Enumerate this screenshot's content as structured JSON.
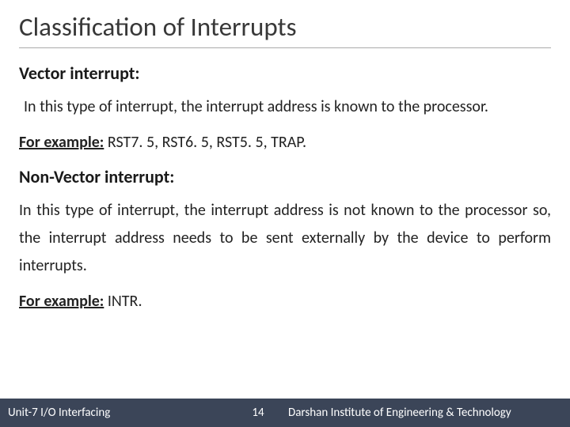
{
  "slide": {
    "title": "Classification of Interrupts",
    "section1": {
      "heading": "Vector interrupt:",
      "body": "In this type of interrupt, the interrupt address is known to the processor.",
      "example_label": "For example:",
      "example_text": " RST7. 5, RST6. 5, RST5. 5, TRAP."
    },
    "section2": {
      "heading": "Non-Vector interrupt:",
      "body": "In this type of interrupt, the interrupt address is not known to the processor so, the interrupt address needs to be sent externally by the device to perform interrupts.",
      "example_label": "For example:",
      "example_text": " INTR."
    }
  },
  "footer": {
    "unit": "Unit-7 I/O Interfacing",
    "page": "14",
    "institute": "Darshan Institute of Engineering & Technology"
  }
}
